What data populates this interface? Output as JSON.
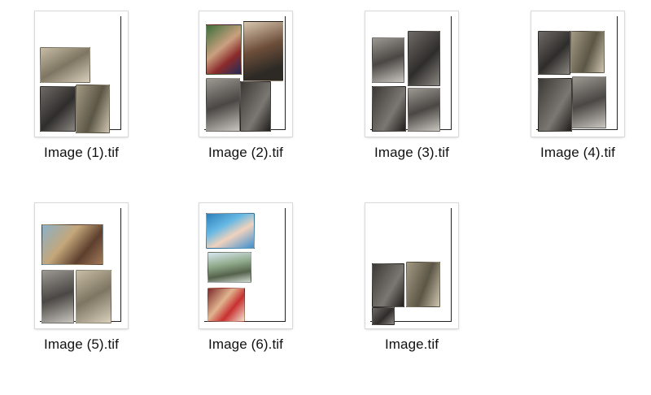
{
  "files": [
    {
      "name": "Image (1).tif"
    },
    {
      "name": "Image (2).tif"
    },
    {
      "name": "Image (3).tif"
    },
    {
      "name": "Image (4).tif"
    },
    {
      "name": "Image (5).tif"
    },
    {
      "name": "Image (6).tif"
    },
    {
      "name": "Image.tif"
    }
  ]
}
